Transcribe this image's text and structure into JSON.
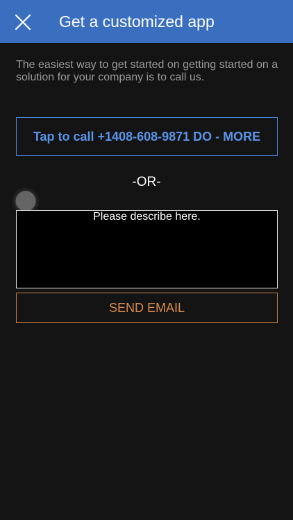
{
  "header": {
    "title": "Get a customized app",
    "close_icon": "close-icon"
  },
  "intro": {
    "text": "The easiest way to get started on getting started on a solution for your company is to call us."
  },
  "call_button": {
    "label": "Tap to call +1408-608-9871 DO - MORE"
  },
  "divider": {
    "label": "-OR-"
  },
  "describe": {
    "placeholder": "Please describe here.",
    "value": ""
  },
  "send_button": {
    "label": "SEND EMAIL"
  },
  "colors": {
    "header_bg": "#3a6fc0",
    "background": "#141414",
    "call_accent": "#5b93e8",
    "send_accent": "#d88a4e"
  }
}
